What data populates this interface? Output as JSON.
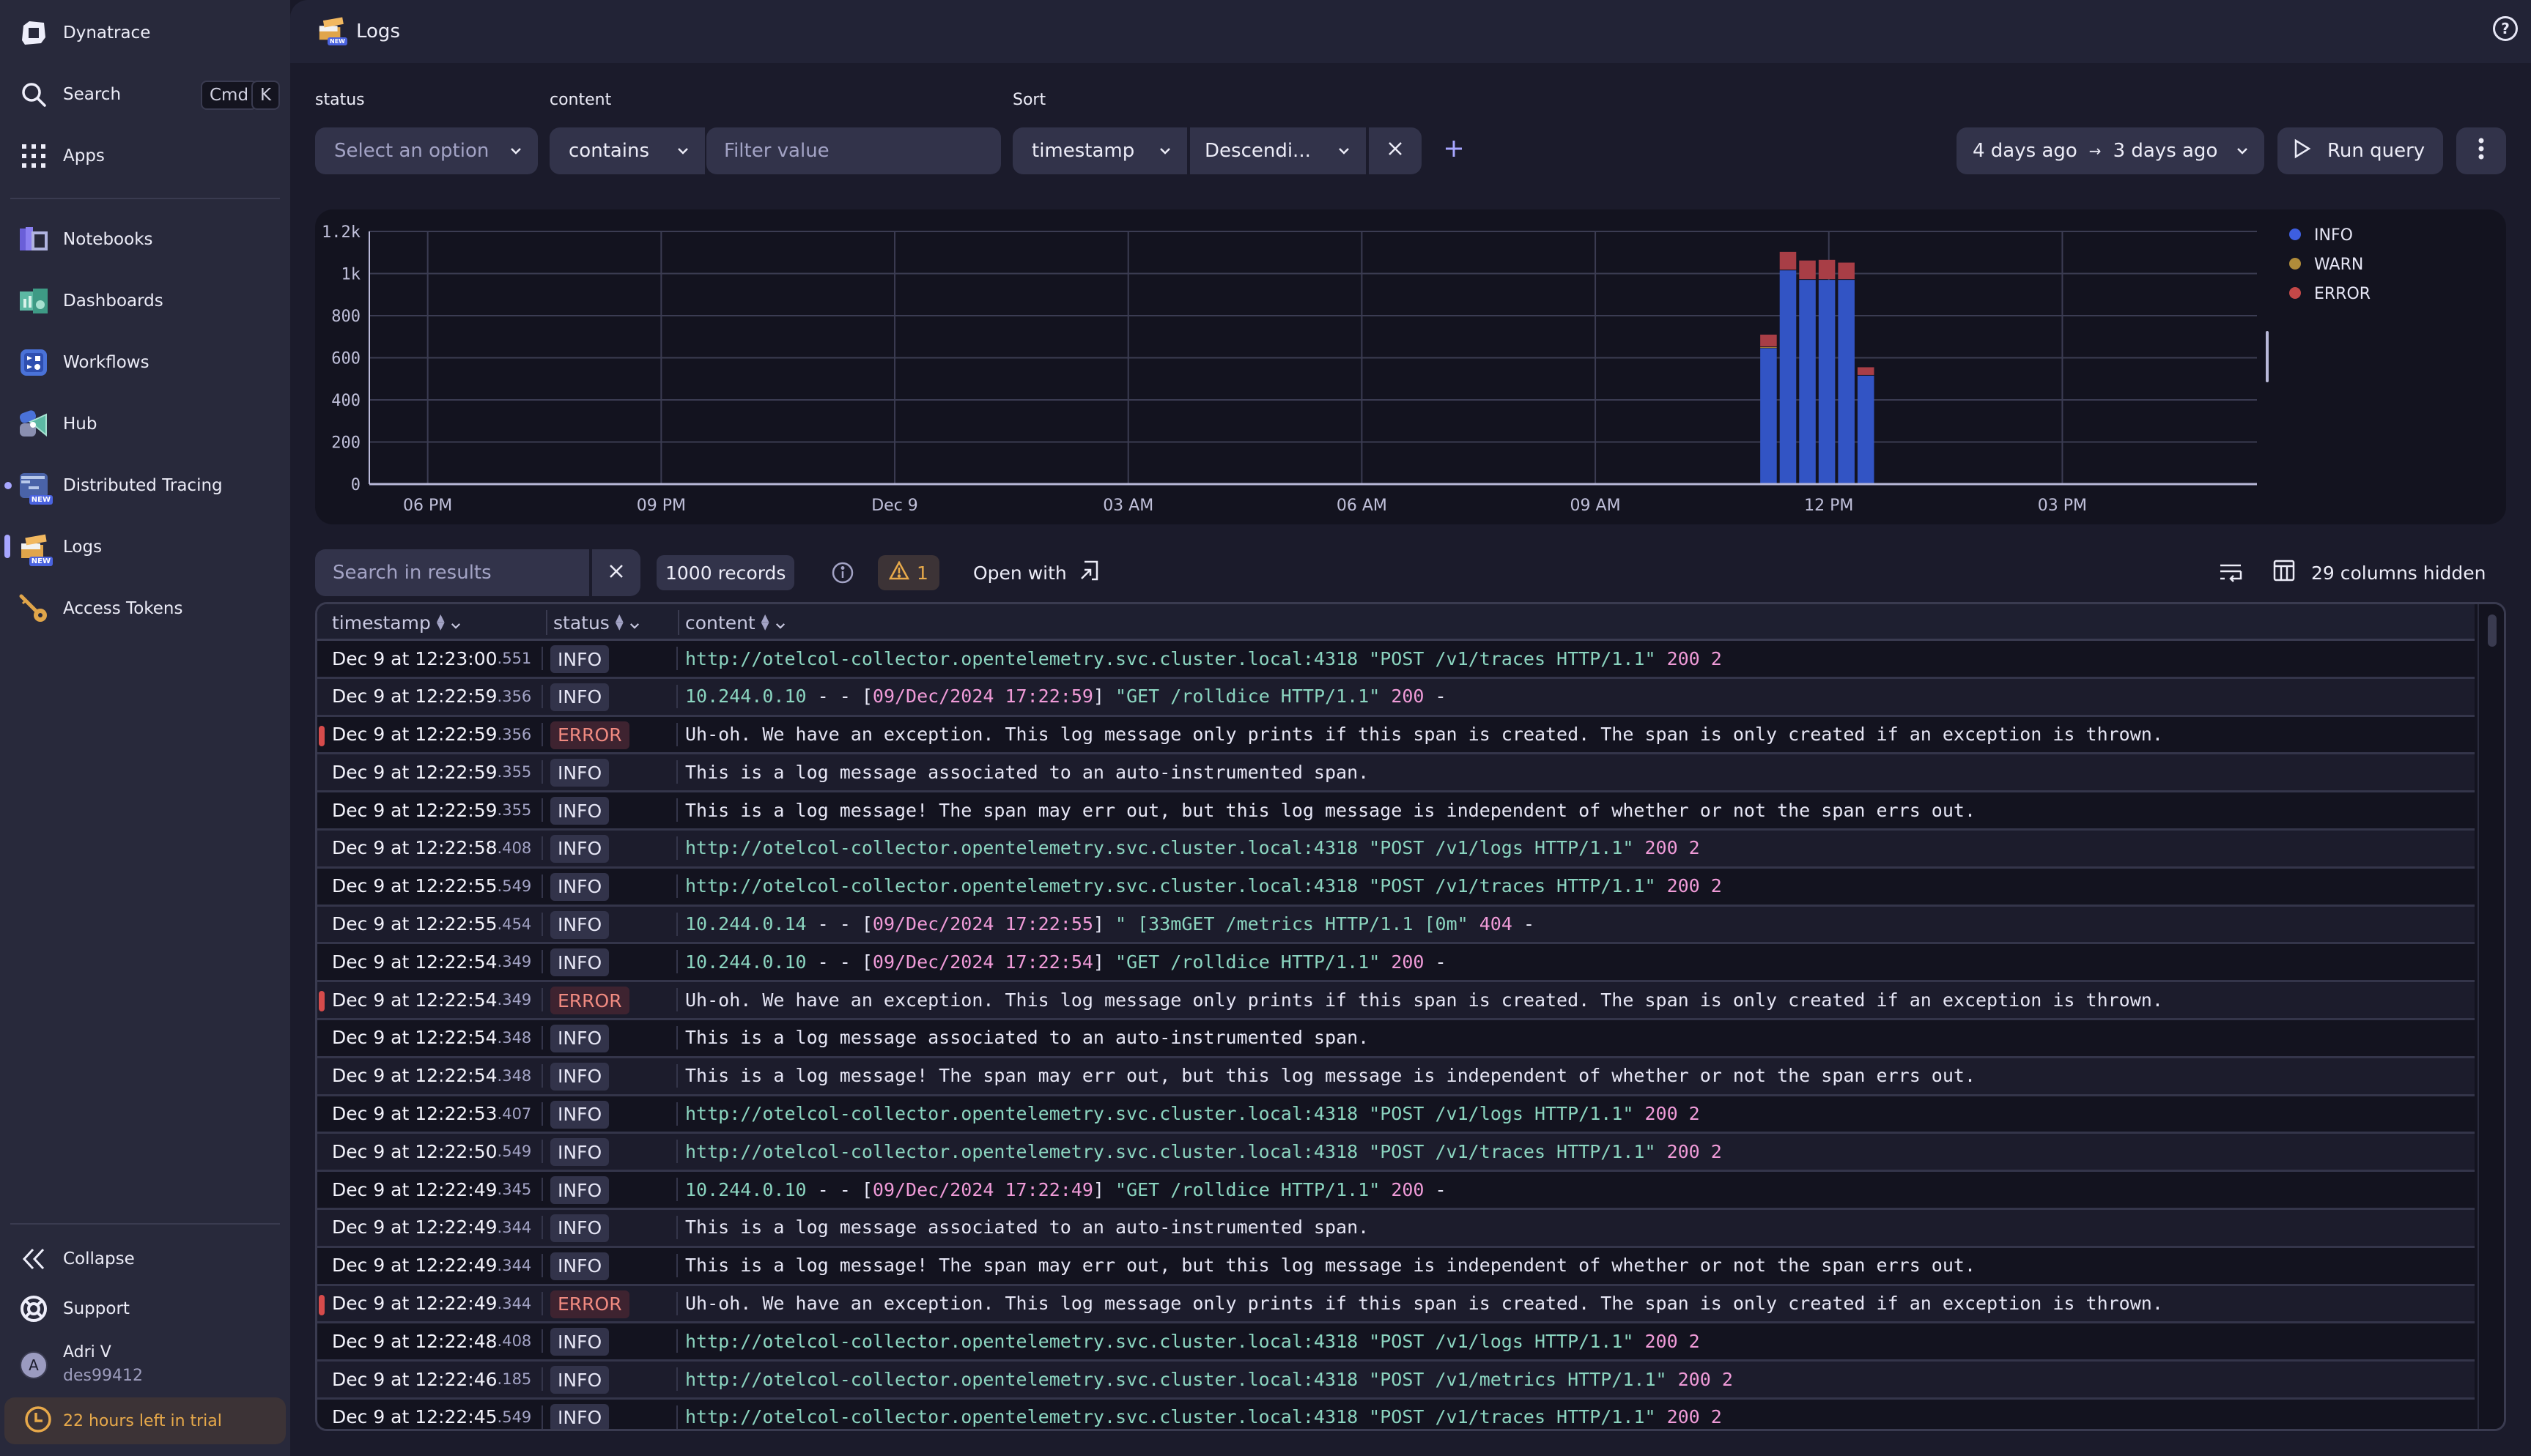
{
  "sidebar": {
    "brand": "Dynatrace",
    "search": {
      "label": "Search",
      "kbd1": "Cmd",
      "kbd2": "K"
    },
    "apps": "Apps",
    "items": [
      {
        "label": "Notebooks",
        "icon": "notebooks-icon"
      },
      {
        "label": "Dashboards",
        "icon": "dashboards-icon"
      },
      {
        "label": "Workflows",
        "icon": "workflows-icon"
      },
      {
        "label": "Hub",
        "icon": "hub-icon"
      },
      {
        "label": "Distributed Tracing",
        "icon": "distributed-tracing-icon",
        "badge": "NEW"
      },
      {
        "label": "Logs",
        "icon": "logs-icon",
        "badge": "NEW",
        "active": true
      },
      {
        "label": "Access Tokens",
        "icon": "key-icon"
      }
    ],
    "collapse": "Collapse",
    "support": "Support",
    "user": {
      "initial": "A",
      "name": "Adri V",
      "id": "des99412"
    },
    "trial": "22 hours left in trial"
  },
  "header": {
    "title": "Logs",
    "badge": "NEW"
  },
  "filters": {
    "status_label": "status",
    "status_placeholder": "Select an option",
    "content_label": "content",
    "content_operator": "contains",
    "content_placeholder": "Filter value",
    "sort_label": "Sort",
    "sort_field": "timestamp",
    "sort_order": "Descendi...",
    "timeframe_from": "4 days ago",
    "timeframe_arrow": "→",
    "timeframe_to": "3 days ago",
    "run_query": "Run query"
  },
  "chart_data": {
    "type": "bar",
    "stacked": true,
    "title": "",
    "xlabel": "",
    "ylabel": "",
    "ylim": [
      0,
      1200
    ],
    "yticks": [
      "0",
      "200",
      "400",
      "600",
      "800",
      "1k",
      "1.2k"
    ],
    "ytick_values": [
      0,
      200,
      400,
      600,
      800,
      1000,
      1200
    ],
    "xticks": [
      "06 PM",
      "09 PM",
      "Dec 9",
      "03 AM",
      "06 AM",
      "09 AM",
      "12 PM",
      "03 PM"
    ],
    "x_range_hours": [
      -0.75,
      23.5
    ],
    "xtick_hours": [
      0,
      3,
      6,
      9,
      12,
      15,
      18,
      21
    ],
    "bar_start_hours": [
      17.1,
      17.35,
      17.6,
      17.85,
      18.1,
      18.35
    ],
    "bar_width_hours": 0.25,
    "grid": true,
    "legend_position": "right",
    "series": [
      {
        "name": "INFO",
        "color": "#3254c4",
        "values": [
          645,
          1015,
          970,
          970,
          970,
          515
        ]
      },
      {
        "name": "WARN",
        "color": "#b08c3a",
        "values": [
          5,
          0,
          0,
          0,
          0,
          0
        ]
      },
      {
        "name": "ERROR",
        "color": "#a83e46",
        "values": [
          60,
          88,
          92,
          95,
          82,
          40
        ]
      }
    ]
  },
  "results": {
    "search_placeholder": "Search in results",
    "records": "1000 records",
    "warnings": "1",
    "open_with": "Open with",
    "columns_hidden": "29 columns hidden",
    "columns": [
      "timestamp",
      "status",
      "content"
    ],
    "rows": [
      {
        "ts": "Dec 9 at 12:23:00",
        "ms": ".551",
        "status": "INFO",
        "content": [
          [
            "teal",
            "http://otelcol-collector.opentelemetry.svc.cluster.local:4318 \"POST /v1/traces HTTP/1.1\" "
          ],
          [
            "pink",
            "200 2"
          ]
        ]
      },
      {
        "ts": "Dec 9 at 12:22:59",
        "ms": ".356",
        "status": "INFO",
        "content": [
          [
            "teal",
            "10.244.0.10 "
          ],
          [
            "white",
            "- - ["
          ],
          [
            "pink",
            "09/Dec/2024 17:22:59"
          ],
          [
            "white",
            "] "
          ],
          [
            "teal",
            "\"GET /rolldice HTTP/1.1\" "
          ],
          [
            "pink",
            "200 "
          ],
          [
            "white",
            "-"
          ]
        ]
      },
      {
        "ts": "Dec 9 at 12:22:59",
        "ms": ".356",
        "status": "ERROR",
        "content": [
          [
            "white",
            "Uh-oh. We have an exception. This log message only prints if this span is created. The span is only created if an exception is thrown."
          ]
        ]
      },
      {
        "ts": "Dec 9 at 12:22:59",
        "ms": ".355",
        "status": "INFO",
        "content": [
          [
            "white",
            "This is a log message associated to an auto-instrumented span."
          ]
        ]
      },
      {
        "ts": "Dec 9 at 12:22:59",
        "ms": ".355",
        "status": "INFO",
        "content": [
          [
            "white",
            "This is a log message! The span may err out, but this log message is independent of whether or not the span errs out."
          ]
        ]
      },
      {
        "ts": "Dec 9 at 12:22:58",
        "ms": ".408",
        "status": "INFO",
        "content": [
          [
            "teal",
            "http://otelcol-collector.opentelemetry.svc.cluster.local:4318 \"POST /v1/logs HTTP/1.1\" "
          ],
          [
            "pink",
            "200 2"
          ]
        ]
      },
      {
        "ts": "Dec 9 at 12:22:55",
        "ms": ".549",
        "status": "INFO",
        "content": [
          [
            "teal",
            "http://otelcol-collector.opentelemetry.svc.cluster.local:4318 \"POST /v1/traces HTTP/1.1\" "
          ],
          [
            "pink",
            "200 2"
          ]
        ]
      },
      {
        "ts": "Dec 9 at 12:22:55",
        "ms": ".454",
        "status": "INFO",
        "content": [
          [
            "teal",
            "10.244.0.14 "
          ],
          [
            "white",
            "- - ["
          ],
          [
            "pink",
            "09/Dec/2024 17:22:55"
          ],
          [
            "white",
            "] "
          ],
          [
            "teal",
            "\" [33mGET /metrics HTTP/1.1 [0m\" "
          ],
          [
            "pink",
            "404 "
          ],
          [
            "white",
            "-"
          ]
        ]
      },
      {
        "ts": "Dec 9 at 12:22:54",
        "ms": ".349",
        "status": "INFO",
        "content": [
          [
            "teal",
            "10.244.0.10 "
          ],
          [
            "white",
            "- - ["
          ],
          [
            "pink",
            "09/Dec/2024 17:22:54"
          ],
          [
            "white",
            "] "
          ],
          [
            "teal",
            "\"GET /rolldice HTTP/1.1\" "
          ],
          [
            "pink",
            "200 "
          ],
          [
            "white",
            "-"
          ]
        ]
      },
      {
        "ts": "Dec 9 at 12:22:54",
        "ms": ".349",
        "status": "ERROR",
        "content": [
          [
            "white",
            "Uh-oh. We have an exception. This log message only prints if this span is created. The span is only created if an exception is thrown."
          ]
        ]
      },
      {
        "ts": "Dec 9 at 12:22:54",
        "ms": ".348",
        "status": "INFO",
        "content": [
          [
            "white",
            "This is a log message associated to an auto-instrumented span."
          ]
        ]
      },
      {
        "ts": "Dec 9 at 12:22:54",
        "ms": ".348",
        "status": "INFO",
        "content": [
          [
            "white",
            "This is a log message! The span may err out, but this log message is independent of whether or not the span errs out."
          ]
        ]
      },
      {
        "ts": "Dec 9 at 12:22:53",
        "ms": ".407",
        "status": "INFO",
        "content": [
          [
            "teal",
            "http://otelcol-collector.opentelemetry.svc.cluster.local:4318 \"POST /v1/logs HTTP/1.1\" "
          ],
          [
            "pink",
            "200 2"
          ]
        ]
      },
      {
        "ts": "Dec 9 at 12:22:50",
        "ms": ".549",
        "status": "INFO",
        "content": [
          [
            "teal",
            "http://otelcol-collector.opentelemetry.svc.cluster.local:4318 \"POST /v1/traces HTTP/1.1\" "
          ],
          [
            "pink",
            "200 2"
          ]
        ]
      },
      {
        "ts": "Dec 9 at 12:22:49",
        "ms": ".345",
        "status": "INFO",
        "content": [
          [
            "teal",
            "10.244.0.10 "
          ],
          [
            "white",
            "- - ["
          ],
          [
            "pink",
            "09/Dec/2024 17:22:49"
          ],
          [
            "white",
            "] "
          ],
          [
            "teal",
            "\"GET /rolldice HTTP/1.1\" "
          ],
          [
            "pink",
            "200 "
          ],
          [
            "white",
            "-"
          ]
        ]
      },
      {
        "ts": "Dec 9 at 12:22:49",
        "ms": ".344",
        "status": "INFO",
        "content": [
          [
            "white",
            "This is a log message associated to an auto-instrumented span."
          ]
        ]
      },
      {
        "ts": "Dec 9 at 12:22:49",
        "ms": ".344",
        "status": "INFO",
        "content": [
          [
            "white",
            "This is a log message! The span may err out, but this log message is independent of whether or not the span errs out."
          ]
        ]
      },
      {
        "ts": "Dec 9 at 12:22:49",
        "ms": ".344",
        "status": "ERROR",
        "content": [
          [
            "white",
            "Uh-oh. We have an exception. This log message only prints if this span is created. The span is only created if an exception is thrown."
          ]
        ]
      },
      {
        "ts": "Dec 9 at 12:22:48",
        "ms": ".408",
        "status": "INFO",
        "content": [
          [
            "teal",
            "http://otelcol-collector.opentelemetry.svc.cluster.local:4318 \"POST /v1/logs HTTP/1.1\" "
          ],
          [
            "pink",
            "200 2"
          ]
        ]
      },
      {
        "ts": "Dec 9 at 12:22:46",
        "ms": ".185",
        "status": "INFO",
        "content": [
          [
            "teal",
            "http://otelcol-collector.opentelemetry.svc.cluster.local:4318 \"POST /v1/metrics HTTP/1.1\" "
          ],
          [
            "pink",
            "200 2"
          ]
        ]
      },
      {
        "ts": "Dec 9 at 12:22:45",
        "ms": ".549",
        "status": "INFO",
        "content": [
          [
            "teal",
            "http://otelcol-collector.opentelemetry.svc.cluster.local:4318 \"POST /v1/traces HTTP/1.1\" "
          ],
          [
            "pink",
            "200 2"
          ]
        ]
      }
    ]
  }
}
